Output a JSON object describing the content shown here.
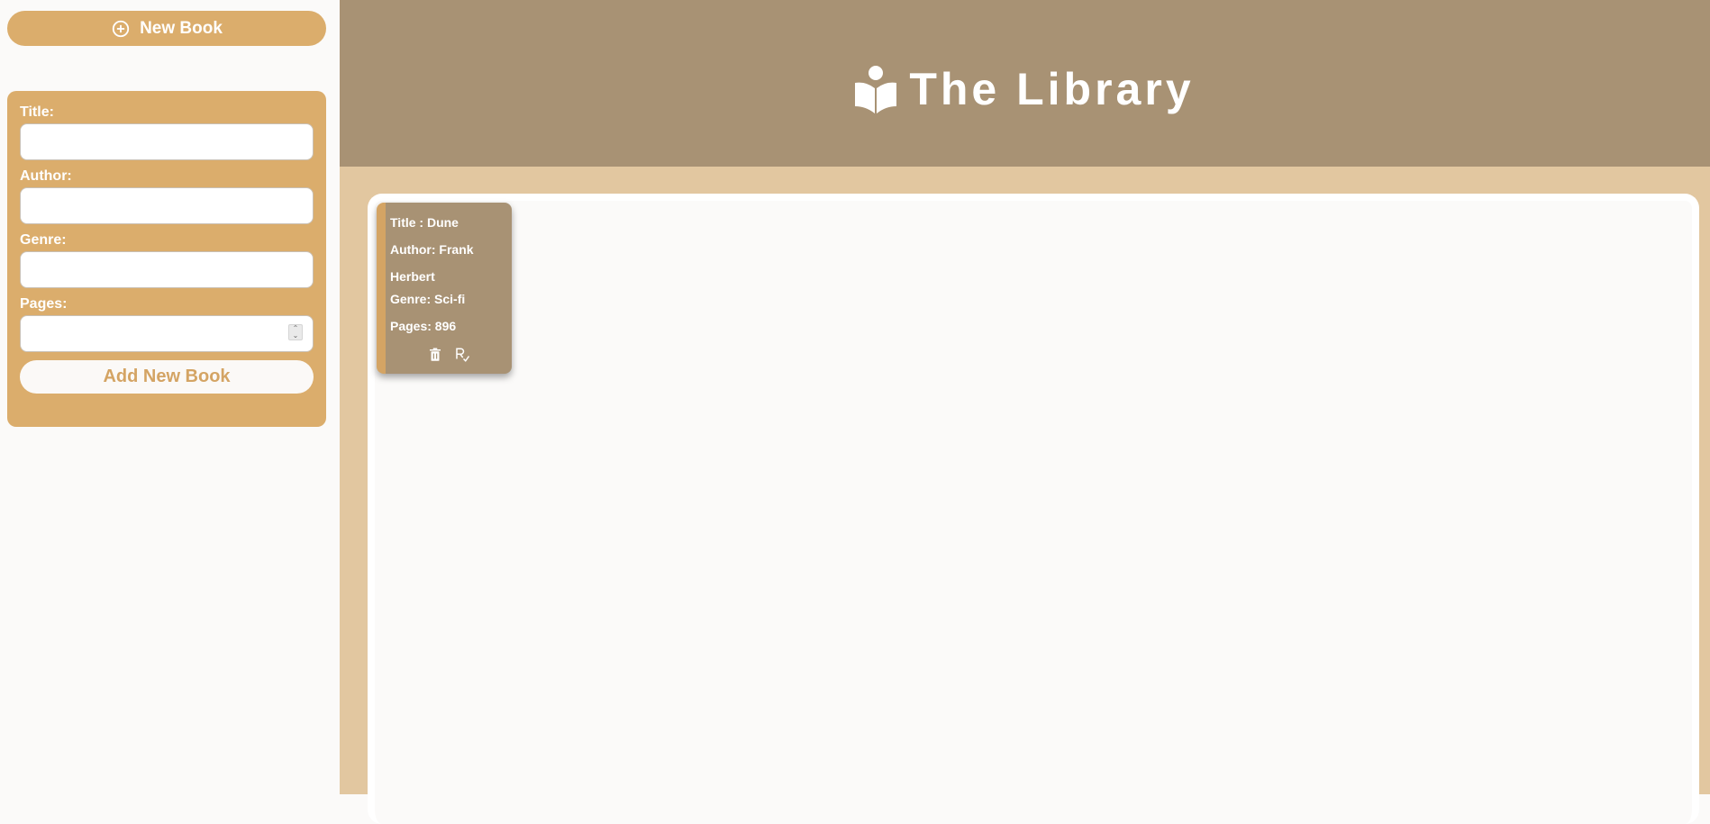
{
  "sidebar": {
    "new_book_label": "New Book",
    "form": {
      "title_label": "Title:",
      "author_label": "Author:",
      "genre_label": "Genre:",
      "pages_label": "Pages:",
      "title_value": "",
      "author_value": "",
      "genre_value": "",
      "pages_value": "",
      "submit_label": "Add New Book"
    }
  },
  "header": {
    "title": "The Library",
    "icon": "reader-book-icon"
  },
  "books": [
    {
      "title_text": "Title : Dune",
      "author_text": "Author: Frank Herbert",
      "genre_text": "Genre: Sci-fi",
      "pages_text": "Pages: 896",
      "actions": [
        "trash-icon",
        "read-check-icon"
      ]
    }
  ],
  "colors": {
    "accent": "#dbad6c",
    "header": "#a89274",
    "content_bg": "#e2c7a0",
    "panel": "#fbfaf9"
  }
}
